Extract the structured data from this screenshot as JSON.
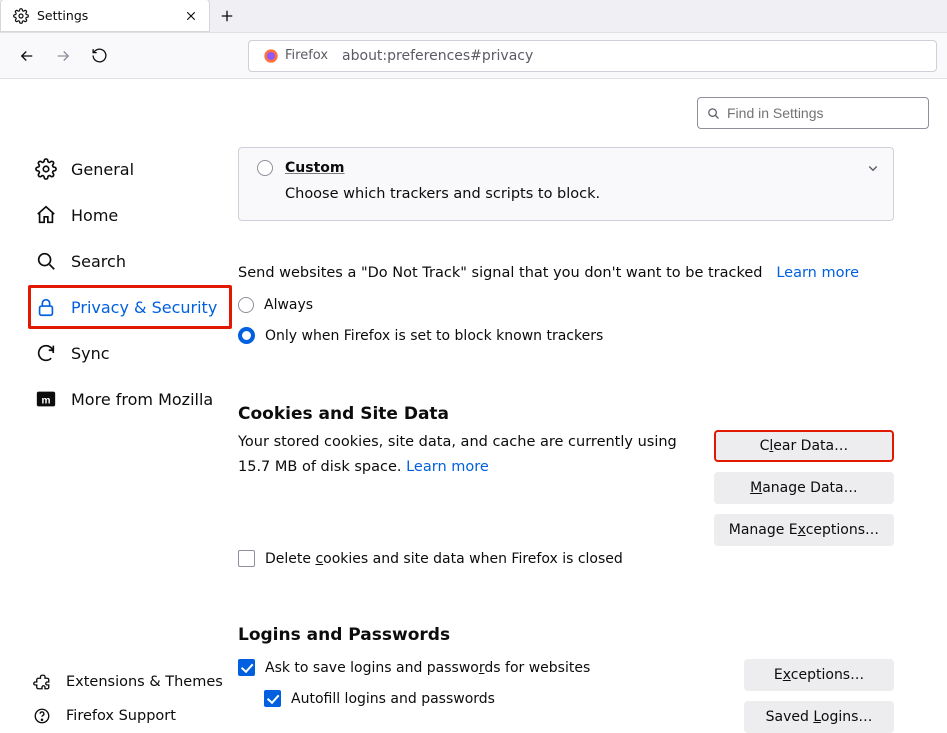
{
  "tab": {
    "title": "Settings"
  },
  "urlbar": {
    "identity": "Firefox",
    "url": "about:preferences#privacy"
  },
  "search": {
    "placeholder": "Find in Settings"
  },
  "sidebar": {
    "items": [
      {
        "label": "General"
      },
      {
        "label": "Home"
      },
      {
        "label": "Search"
      },
      {
        "label": "Privacy & Security"
      },
      {
        "label": "Sync"
      },
      {
        "label": "More from Mozilla"
      }
    ],
    "footer": [
      {
        "label": "Extensions & Themes"
      },
      {
        "label": "Firefox Support"
      }
    ]
  },
  "custom": {
    "title": "Custom",
    "desc": "Choose which trackers and scripts to block."
  },
  "dnt": {
    "text": "Send websites a \"Do Not Track\" signal that you don't want to be tracked",
    "learn": "Learn more",
    "always": "Always",
    "only": "Only when Firefox is set to block known trackers"
  },
  "cookies": {
    "title": "Cookies and Site Data",
    "text_pre": "Your stored cookies, site data, and cache are currently using ",
    "size": "15.7 MB",
    "text_post": " of disk space.   ",
    "learn": "Learn more",
    "delete": "Delete cookies and site data when Firefox is closed",
    "clear": "Clear Data…",
    "manage": "Manage Data…",
    "exceptions": "Manage Exceptions…"
  },
  "logins": {
    "title": "Logins and Passwords",
    "ask": "Ask to save logins and passwords for websites",
    "autofill": "Autofill logins and passwords",
    "exceptions": "Exceptions…",
    "saved": "Saved Logins…"
  }
}
